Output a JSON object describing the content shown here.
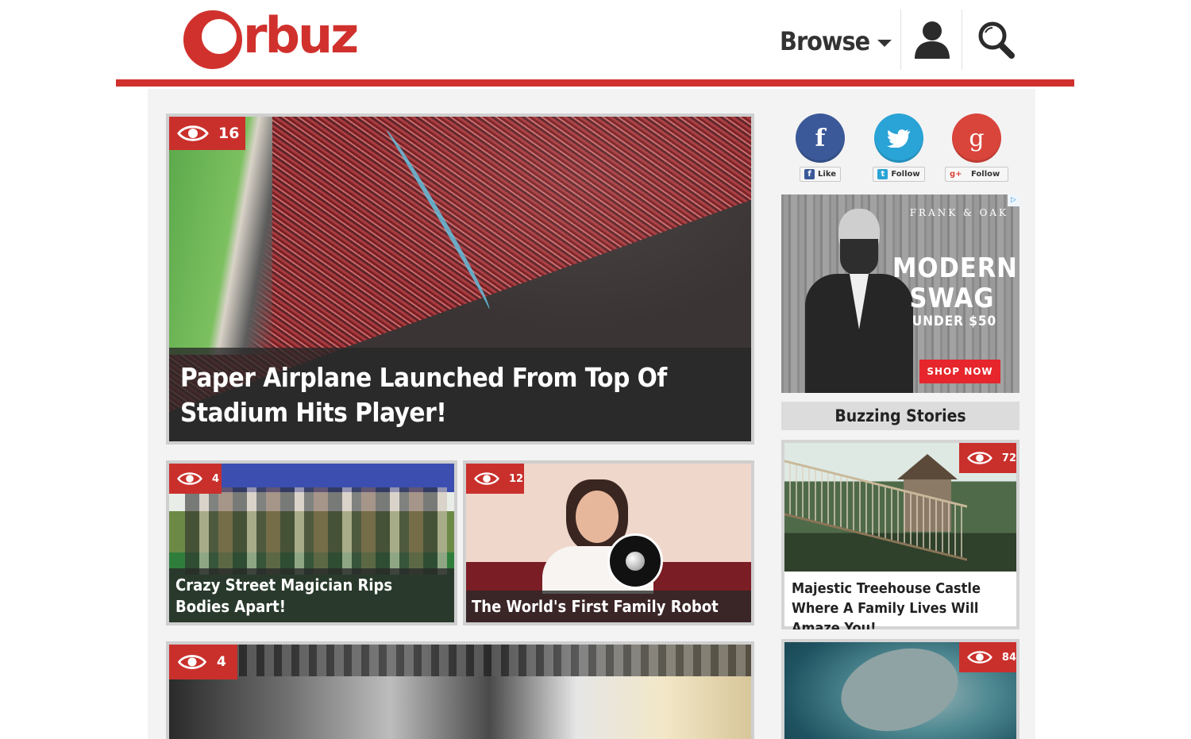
{
  "brand": {
    "logo_text": "rbuz",
    "accent_color": "#d0312d"
  },
  "nav": {
    "browse_label": "Browse",
    "user_icon": "user-icon",
    "search_icon": "search-icon"
  },
  "hero": {
    "views": "16",
    "title": "Paper Airplane Launched From Top Of Stadium Hits Player!"
  },
  "posts": [
    {
      "views": "4",
      "title": "Crazy Street Magician Rips Bodies Apart!"
    },
    {
      "views": "12",
      "title": "The World's First Family Robot"
    },
    {
      "views": "4",
      "title": ""
    }
  ],
  "social": [
    {
      "network": "facebook",
      "glyph": "f",
      "button": "Like",
      "color": "#3b5998"
    },
    {
      "network": "twitter",
      "glyph": "t",
      "button": "Follow",
      "color": "#2aa3d6"
    },
    {
      "network": "google-plus",
      "glyph": "g",
      "button": "Follow",
      "color": "#d9453b"
    }
  ],
  "ad": {
    "brand": "FRANK & OAK",
    "headline_1": "MODERN",
    "headline_2": "SWAG",
    "sub": "UNDER $50",
    "cta": "SHOP NOW"
  },
  "sidebar": {
    "section_title": "Buzzing Stories",
    "stories": [
      {
        "views": "72",
        "title": "Majestic Treehouse Castle Where A Family Lives Will Amaze You!"
      },
      {
        "views": "84",
        "title": ""
      }
    ]
  }
}
